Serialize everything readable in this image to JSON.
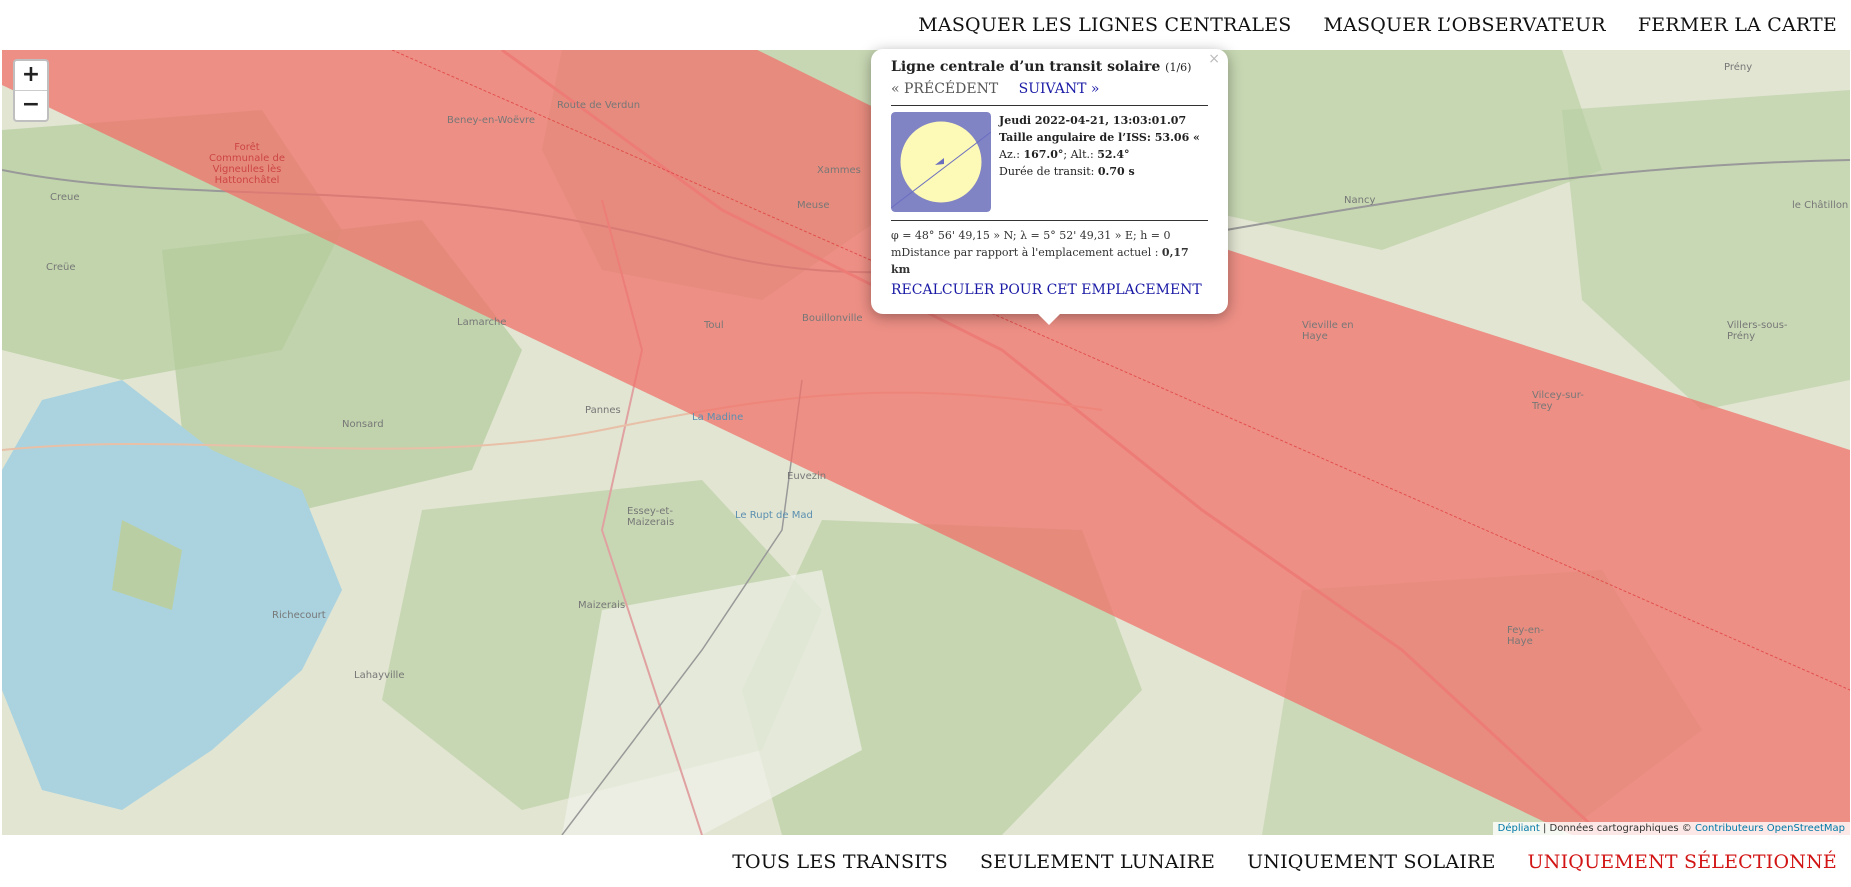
{
  "top_nav": {
    "hide_centerlines": "MASQUER LES LIGNES CENTRALES",
    "hide_observer": "MASQUER L’OBSERVATEUR",
    "close_map": "FERMER LA CARTE"
  },
  "map": {
    "zoom_in": "+",
    "zoom_out": "−",
    "labels": [
      "Forêt Communale de Vigneulles lès Hattonchâtel",
      "Creue",
      "Creüe",
      "Beney-en-Woëvre",
      "Route de Verdun",
      "Toul",
      "Bouillonville",
      "Lamarche",
      "Nonsard",
      "Pannes",
      "Euvezin",
      "Essey-et-Maizerais",
      "Maizerais",
      "Vieville en Haye",
      "Vilcey-sur-Trey",
      "Villers-sous-Prény",
      "Prény",
      "le Châtillon",
      "Nancy",
      "Fey-en-Haye",
      "Richecourt",
      "Lahayville",
      "La Madine",
      "Le Rupt de Mad",
      "Xammes",
      "Meuse"
    ],
    "attribution": {
      "leaflet": "Dépliant",
      "text": "| Données cartographiques ©",
      "osm": "Contributeurs OpenStreetMap"
    },
    "colors": {
      "transit_band": "#f0716b",
      "water": "#aad3df",
      "forest": "#add19e"
    },
    "icons": [
      "observer-pin-icon-green",
      "transit-pin-icon-blue"
    ]
  },
  "popup": {
    "title": "Ligne centrale d’un transit solaire",
    "counter": "(1/6)",
    "close": "×",
    "prev": "« PRÉCÉDENT",
    "next": "SUIVANT »",
    "date": "Jeudi 2022-04-21, 13:03:01.07",
    "angular_size_label": "Taille angulaire de l’ISS:",
    "angular_size_value": "53.06 «",
    "az_label": "Az.:",
    "az_value": "167.0°",
    "alt_label": "; Alt.:",
    "alt_value": "52.4°",
    "duration_label": "Durée de transit:",
    "duration_value": "0.70 s",
    "coords": "φ = 48° 56' 49,15 » N; λ = 5° 52' 49,31 » E; h = 0 mDistance par rapport à l'emplacement actuel :",
    "distance_value": "0,17 km",
    "recalculate": "RECALCULER POUR CET EMPLACEMENT",
    "sun_color": "#fdf9b6",
    "sky_color": "#8083c4"
  },
  "bottom_nav": {
    "all": "TOUS LES TRANSITS",
    "lunar": "SEULEMENT LUNAIRE",
    "solar": "UNIQUEMENT SOLAIRE",
    "selected": "UNIQUEMENT SÉLECTIONNÉ"
  }
}
